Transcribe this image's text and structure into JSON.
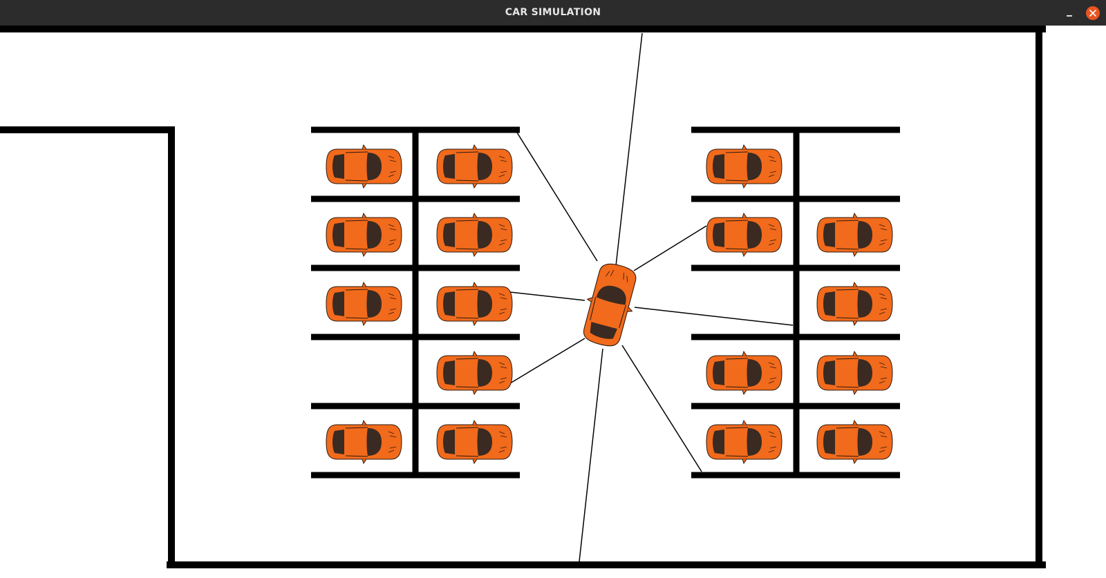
{
  "window": {
    "title": "CAR SIMULATION"
  },
  "colors": {
    "titlebar": "#2c2c2c",
    "close": "#e95420",
    "car_body": "#f26a1b",
    "car_glass": "#3a2a22",
    "wall": "#000000"
  },
  "icons": {
    "minimize": "minimize-icon",
    "close": "close-icon"
  },
  "parking": {
    "left_lot": {
      "left_column": [
        true,
        true,
        true,
        false,
        true
      ],
      "right_column": [
        true,
        true,
        true,
        true,
        true
      ]
    },
    "right_lot": {
      "left_column": [
        true,
        true,
        false,
        true,
        true
      ],
      "right_column": [
        false,
        true,
        true,
        true,
        true
      ]
    }
  },
  "sensor_rays": 8
}
